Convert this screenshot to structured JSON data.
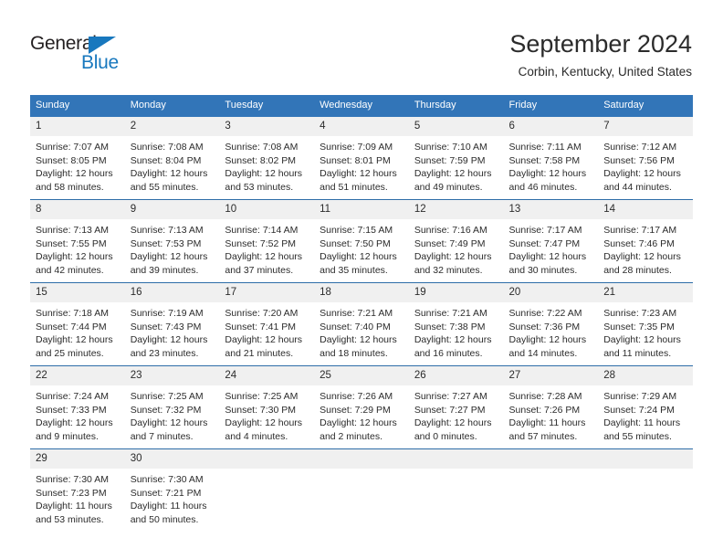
{
  "logo": {
    "word1": "General",
    "word2": "Blue",
    "triangle_color": "#1878be",
    "word1_color": "#231f20",
    "word2_color": "#1878be"
  },
  "header": {
    "title": "September 2024",
    "subtitle": "Corbin, Kentucky, United States"
  },
  "theme": {
    "header_blue": "#3275b8",
    "row_divider_blue": "#2e6da8",
    "daynum_band": "#f0f0f0",
    "text": "#2b2b2b"
  },
  "calendar": {
    "weekday_headers": [
      "Sunday",
      "Monday",
      "Tuesday",
      "Wednesday",
      "Thursday",
      "Friday",
      "Saturday"
    ],
    "weeks": [
      {
        "days": [
          {
            "num": "1",
            "sunrise": "Sunrise: 7:07 AM",
            "sunset": "Sunset: 8:05 PM",
            "daylight1": "Daylight: 12 hours",
            "daylight2": "and 58 minutes."
          },
          {
            "num": "2",
            "sunrise": "Sunrise: 7:08 AM",
            "sunset": "Sunset: 8:04 PM",
            "daylight1": "Daylight: 12 hours",
            "daylight2": "and 55 minutes."
          },
          {
            "num": "3",
            "sunrise": "Sunrise: 7:08 AM",
            "sunset": "Sunset: 8:02 PM",
            "daylight1": "Daylight: 12 hours",
            "daylight2": "and 53 minutes."
          },
          {
            "num": "4",
            "sunrise": "Sunrise: 7:09 AM",
            "sunset": "Sunset: 8:01 PM",
            "daylight1": "Daylight: 12 hours",
            "daylight2": "and 51 minutes."
          },
          {
            "num": "5",
            "sunrise": "Sunrise: 7:10 AM",
            "sunset": "Sunset: 7:59 PM",
            "daylight1": "Daylight: 12 hours",
            "daylight2": "and 49 minutes."
          },
          {
            "num": "6",
            "sunrise": "Sunrise: 7:11 AM",
            "sunset": "Sunset: 7:58 PM",
            "daylight1": "Daylight: 12 hours",
            "daylight2": "and 46 minutes."
          },
          {
            "num": "7",
            "sunrise": "Sunrise: 7:12 AM",
            "sunset": "Sunset: 7:56 PM",
            "daylight1": "Daylight: 12 hours",
            "daylight2": "and 44 minutes."
          }
        ]
      },
      {
        "days": [
          {
            "num": "8",
            "sunrise": "Sunrise: 7:13 AM",
            "sunset": "Sunset: 7:55 PM",
            "daylight1": "Daylight: 12 hours",
            "daylight2": "and 42 minutes."
          },
          {
            "num": "9",
            "sunrise": "Sunrise: 7:13 AM",
            "sunset": "Sunset: 7:53 PM",
            "daylight1": "Daylight: 12 hours",
            "daylight2": "and 39 minutes."
          },
          {
            "num": "10",
            "sunrise": "Sunrise: 7:14 AM",
            "sunset": "Sunset: 7:52 PM",
            "daylight1": "Daylight: 12 hours",
            "daylight2": "and 37 minutes."
          },
          {
            "num": "11",
            "sunrise": "Sunrise: 7:15 AM",
            "sunset": "Sunset: 7:50 PM",
            "daylight1": "Daylight: 12 hours",
            "daylight2": "and 35 minutes."
          },
          {
            "num": "12",
            "sunrise": "Sunrise: 7:16 AM",
            "sunset": "Sunset: 7:49 PM",
            "daylight1": "Daylight: 12 hours",
            "daylight2": "and 32 minutes."
          },
          {
            "num": "13",
            "sunrise": "Sunrise: 7:17 AM",
            "sunset": "Sunset: 7:47 PM",
            "daylight1": "Daylight: 12 hours",
            "daylight2": "and 30 minutes."
          },
          {
            "num": "14",
            "sunrise": "Sunrise: 7:17 AM",
            "sunset": "Sunset: 7:46 PM",
            "daylight1": "Daylight: 12 hours",
            "daylight2": "and 28 minutes."
          }
        ]
      },
      {
        "days": [
          {
            "num": "15",
            "sunrise": "Sunrise: 7:18 AM",
            "sunset": "Sunset: 7:44 PM",
            "daylight1": "Daylight: 12 hours",
            "daylight2": "and 25 minutes."
          },
          {
            "num": "16",
            "sunrise": "Sunrise: 7:19 AM",
            "sunset": "Sunset: 7:43 PM",
            "daylight1": "Daylight: 12 hours",
            "daylight2": "and 23 minutes."
          },
          {
            "num": "17",
            "sunrise": "Sunrise: 7:20 AM",
            "sunset": "Sunset: 7:41 PM",
            "daylight1": "Daylight: 12 hours",
            "daylight2": "and 21 minutes."
          },
          {
            "num": "18",
            "sunrise": "Sunrise: 7:21 AM",
            "sunset": "Sunset: 7:40 PM",
            "daylight1": "Daylight: 12 hours",
            "daylight2": "and 18 minutes."
          },
          {
            "num": "19",
            "sunrise": "Sunrise: 7:21 AM",
            "sunset": "Sunset: 7:38 PM",
            "daylight1": "Daylight: 12 hours",
            "daylight2": "and 16 minutes."
          },
          {
            "num": "20",
            "sunrise": "Sunrise: 7:22 AM",
            "sunset": "Sunset: 7:36 PM",
            "daylight1": "Daylight: 12 hours",
            "daylight2": "and 14 minutes."
          },
          {
            "num": "21",
            "sunrise": "Sunrise: 7:23 AM",
            "sunset": "Sunset: 7:35 PM",
            "daylight1": "Daylight: 12 hours",
            "daylight2": "and 11 minutes."
          }
        ]
      },
      {
        "days": [
          {
            "num": "22",
            "sunrise": "Sunrise: 7:24 AM",
            "sunset": "Sunset: 7:33 PM",
            "daylight1": "Daylight: 12 hours",
            "daylight2": "and 9 minutes."
          },
          {
            "num": "23",
            "sunrise": "Sunrise: 7:25 AM",
            "sunset": "Sunset: 7:32 PM",
            "daylight1": "Daylight: 12 hours",
            "daylight2": "and 7 minutes."
          },
          {
            "num": "24",
            "sunrise": "Sunrise: 7:25 AM",
            "sunset": "Sunset: 7:30 PM",
            "daylight1": "Daylight: 12 hours",
            "daylight2": "and 4 minutes."
          },
          {
            "num": "25",
            "sunrise": "Sunrise: 7:26 AM",
            "sunset": "Sunset: 7:29 PM",
            "daylight1": "Daylight: 12 hours",
            "daylight2": "and 2 minutes."
          },
          {
            "num": "26",
            "sunrise": "Sunrise: 7:27 AM",
            "sunset": "Sunset: 7:27 PM",
            "daylight1": "Daylight: 12 hours",
            "daylight2": "and 0 minutes."
          },
          {
            "num": "27",
            "sunrise": "Sunrise: 7:28 AM",
            "sunset": "Sunset: 7:26 PM",
            "daylight1": "Daylight: 11 hours",
            "daylight2": "and 57 minutes."
          },
          {
            "num": "28",
            "sunrise": "Sunrise: 7:29 AM",
            "sunset": "Sunset: 7:24 PM",
            "daylight1": "Daylight: 11 hours",
            "daylight2": "and 55 minutes."
          }
        ]
      },
      {
        "days": [
          {
            "num": "29",
            "sunrise": "Sunrise: 7:30 AM",
            "sunset": "Sunset: 7:23 PM",
            "daylight1": "Daylight: 11 hours",
            "daylight2": "and 53 minutes."
          },
          {
            "num": "30",
            "sunrise": "Sunrise: 7:30 AM",
            "sunset": "Sunset: 7:21 PM",
            "daylight1": "Daylight: 11 hours",
            "daylight2": "and 50 minutes."
          },
          {
            "num": "",
            "sunrise": "",
            "sunset": "",
            "daylight1": "",
            "daylight2": ""
          },
          {
            "num": "",
            "sunrise": "",
            "sunset": "",
            "daylight1": "",
            "daylight2": ""
          },
          {
            "num": "",
            "sunrise": "",
            "sunset": "",
            "daylight1": "",
            "daylight2": ""
          },
          {
            "num": "",
            "sunrise": "",
            "sunset": "",
            "daylight1": "",
            "daylight2": ""
          },
          {
            "num": "",
            "sunrise": "",
            "sunset": "",
            "daylight1": "",
            "daylight2": ""
          }
        ]
      }
    ]
  }
}
